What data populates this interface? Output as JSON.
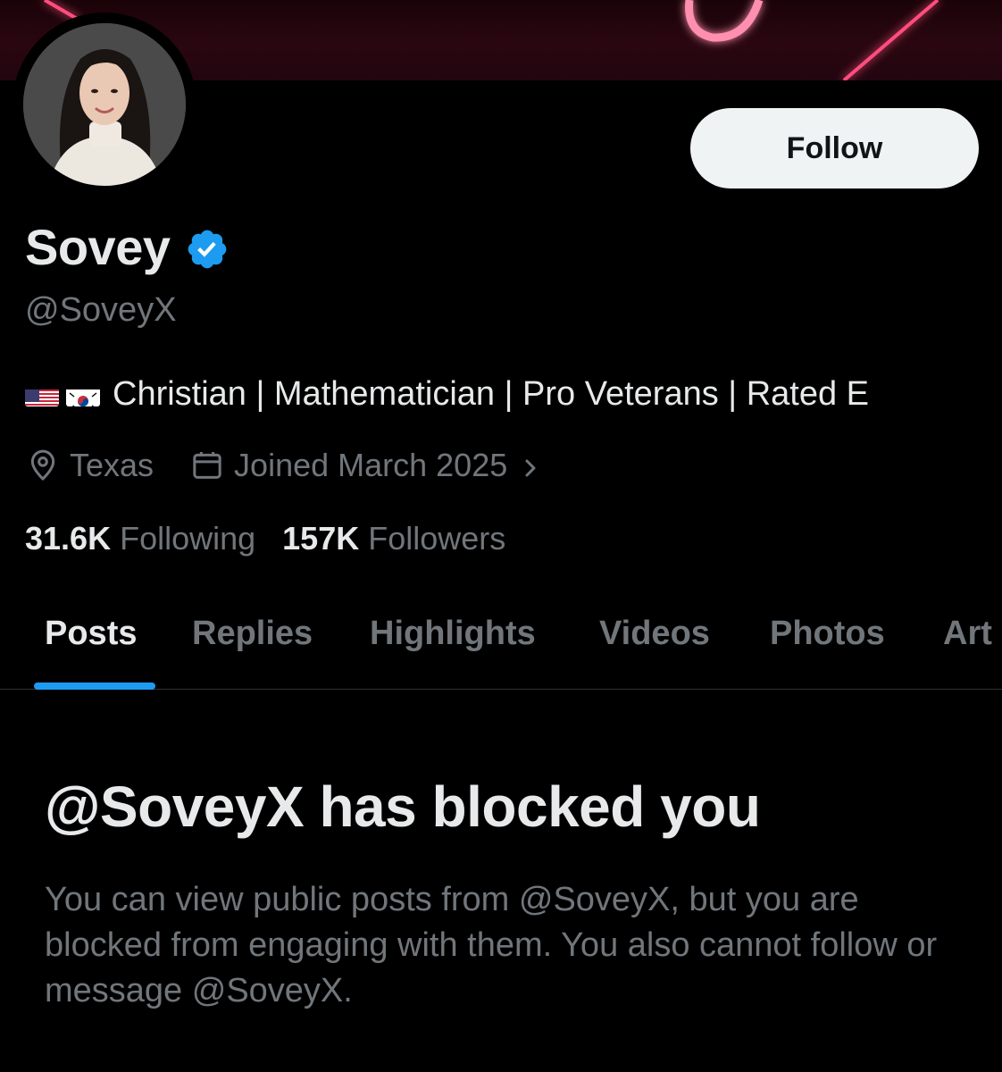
{
  "profile": {
    "display_name": "Sovey",
    "handle": "@SoveyX",
    "flags": [
      "us-flag",
      "south-korea-flag"
    ],
    "bio": "Christian | Mathematician | Pro Veterans | Rated E",
    "location": "Texas",
    "joined": "Joined March 2025",
    "following_count": "31.6K",
    "following_label": "Following",
    "followers_count": "157K",
    "followers_label": "Followers"
  },
  "actions": {
    "follow_label": "Follow"
  },
  "tabs": [
    {
      "label": "Posts",
      "active": true
    },
    {
      "label": "Replies",
      "active": false
    },
    {
      "label": "Highlights",
      "active": false
    },
    {
      "label": "Videos",
      "active": false
    },
    {
      "label": "Photos",
      "active": false
    },
    {
      "label": "Art",
      "active": false
    }
  ],
  "blocked": {
    "title": "@SoveyX has blocked you",
    "description": "You can view public posts from @SoveyX, but you are blocked from engaging with them. You also cannot follow or message @SoveyX."
  },
  "colors": {
    "accent": "#1d9bf0",
    "verified": "#1d9bf0",
    "banner_neon": "#ff3d6e"
  }
}
